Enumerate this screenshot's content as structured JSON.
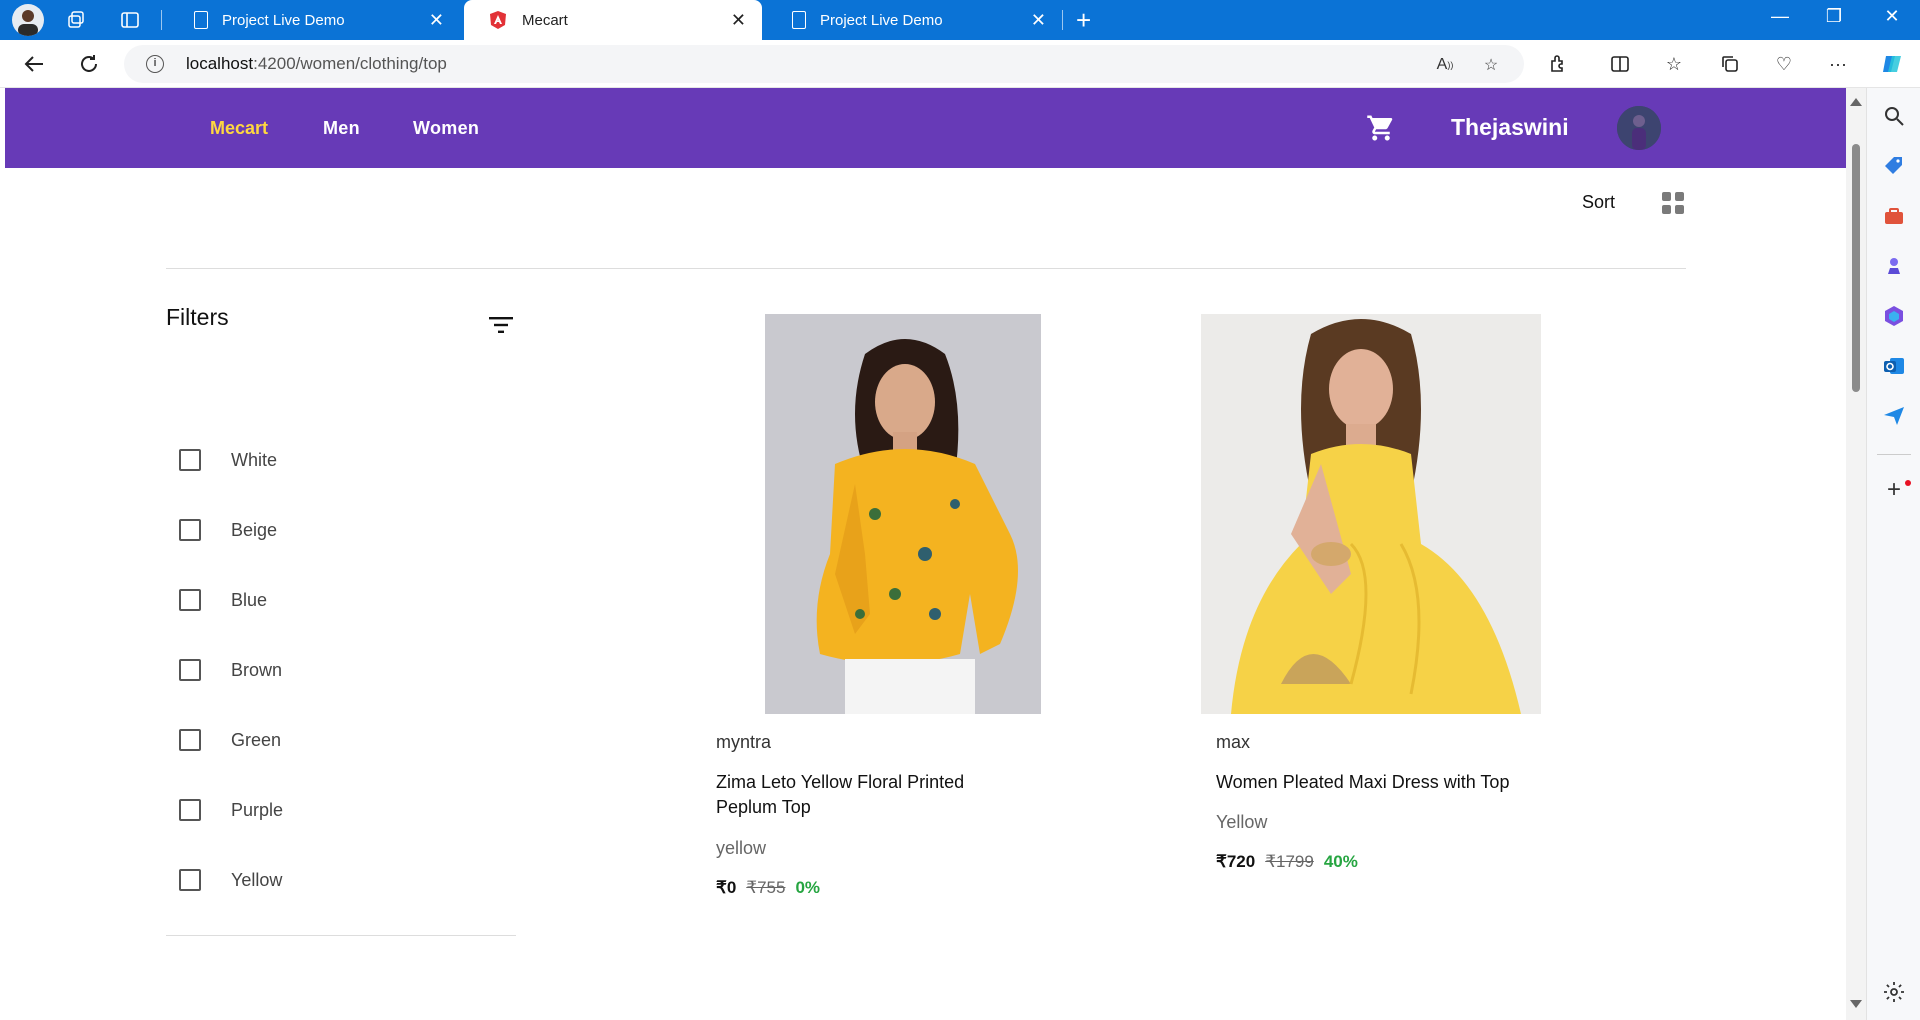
{
  "browser": {
    "tabs": [
      {
        "title": "Project Live Demo",
        "active": false
      },
      {
        "title": "Mecart",
        "active": true
      },
      {
        "title": "Project Live Demo",
        "active": false
      }
    ],
    "url_host": "localhost",
    "url_path": ":4200/women/clothing/top"
  },
  "header": {
    "brand": "Mecart",
    "nav": [
      "Men",
      "Women"
    ],
    "username": "Thejaswini"
  },
  "toolbar": {
    "sort_label": "Sort"
  },
  "filters": {
    "title": "Filters",
    "options": [
      "White",
      "Beige",
      "Blue",
      "Brown",
      "Green",
      "Purple",
      "Yellow"
    ]
  },
  "products": [
    {
      "brand": "myntra",
      "title_line1": "Zima Leto Yellow Floral Printed",
      "title_line2": "Peplum Top",
      "color": "yellow",
      "price": "₹0",
      "mrp": "₹755",
      "discount": "0%"
    },
    {
      "brand": "max",
      "title_line1": "Women Pleated Maxi Dress with Top",
      "title_line2": "",
      "color": "Yellow",
      "price": "₹720",
      "mrp": "₹1799",
      "discount": "40%"
    }
  ],
  "colors": {
    "header_bg": "#673ab7",
    "brand": "#ffd740",
    "discount": "#26a541",
    "browser_tabbar": "#0b73d6"
  }
}
